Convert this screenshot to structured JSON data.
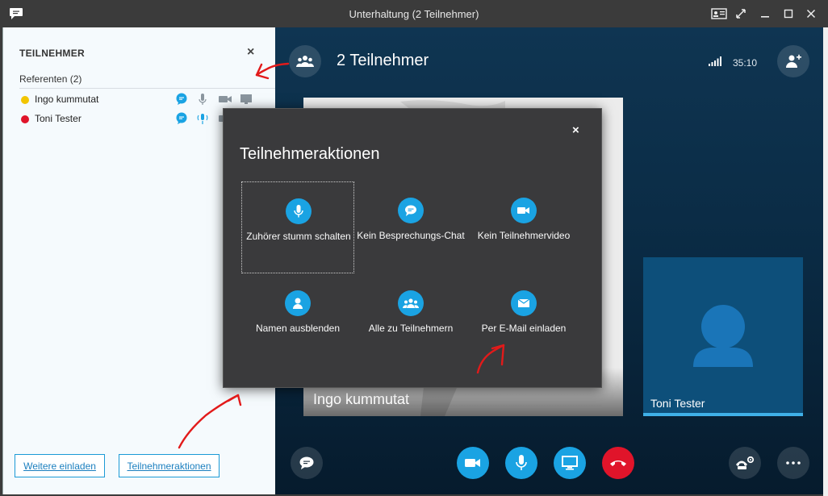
{
  "window": {
    "title": "Unterhaltung (2 Teilnehmer)"
  },
  "left_panel": {
    "heading": "TEILNEHMER",
    "close_glyph": "×",
    "section": "Referenten (2)",
    "participants": [
      {
        "name": "Ingo kummutat",
        "status_color": "#f2c500",
        "status": "away"
      },
      {
        "name": "Toni Tester",
        "status_color": "#e0142a",
        "status": "busy"
      }
    ],
    "buttons": {
      "invite_more": "Weitere einladen",
      "participant_actions": "Teilnehmeraktionen"
    }
  },
  "stage": {
    "title": "2 Teilnehmer",
    "timer": "35:10",
    "main_video_name": "Ingo kummutat",
    "tile_video_name": "Toni Tester"
  },
  "modal": {
    "title": "Teilnehmeraktionen",
    "close_glyph": "×",
    "actions": [
      {
        "label_html_underline": "Z",
        "label_rest": "uhörer stumm schalten",
        "label": "Zuhörer stumm schalten",
        "icon": "microphone-icon",
        "selected": true
      },
      {
        "label": "Kein Besprechungs-Chat",
        "icon": "chat-icon",
        "selected": false
      },
      {
        "label": "Kein Teilnehmervideo",
        "icon": "video-camera-icon",
        "selected": false
      },
      {
        "label": "Namen ausblenden",
        "icon": "person-icon",
        "selected": false
      },
      {
        "label": "Alle zu Teilnehmern",
        "icon": "people-icon",
        "selected": false
      },
      {
        "label": "Per E-Mail einladen",
        "icon": "envelope-icon",
        "selected": false
      }
    ]
  },
  "colors": {
    "accent": "#1aa3e3",
    "hangup": "#e0142a",
    "stage_bg": "#0f3552",
    "annotation": "#e21a1a"
  }
}
